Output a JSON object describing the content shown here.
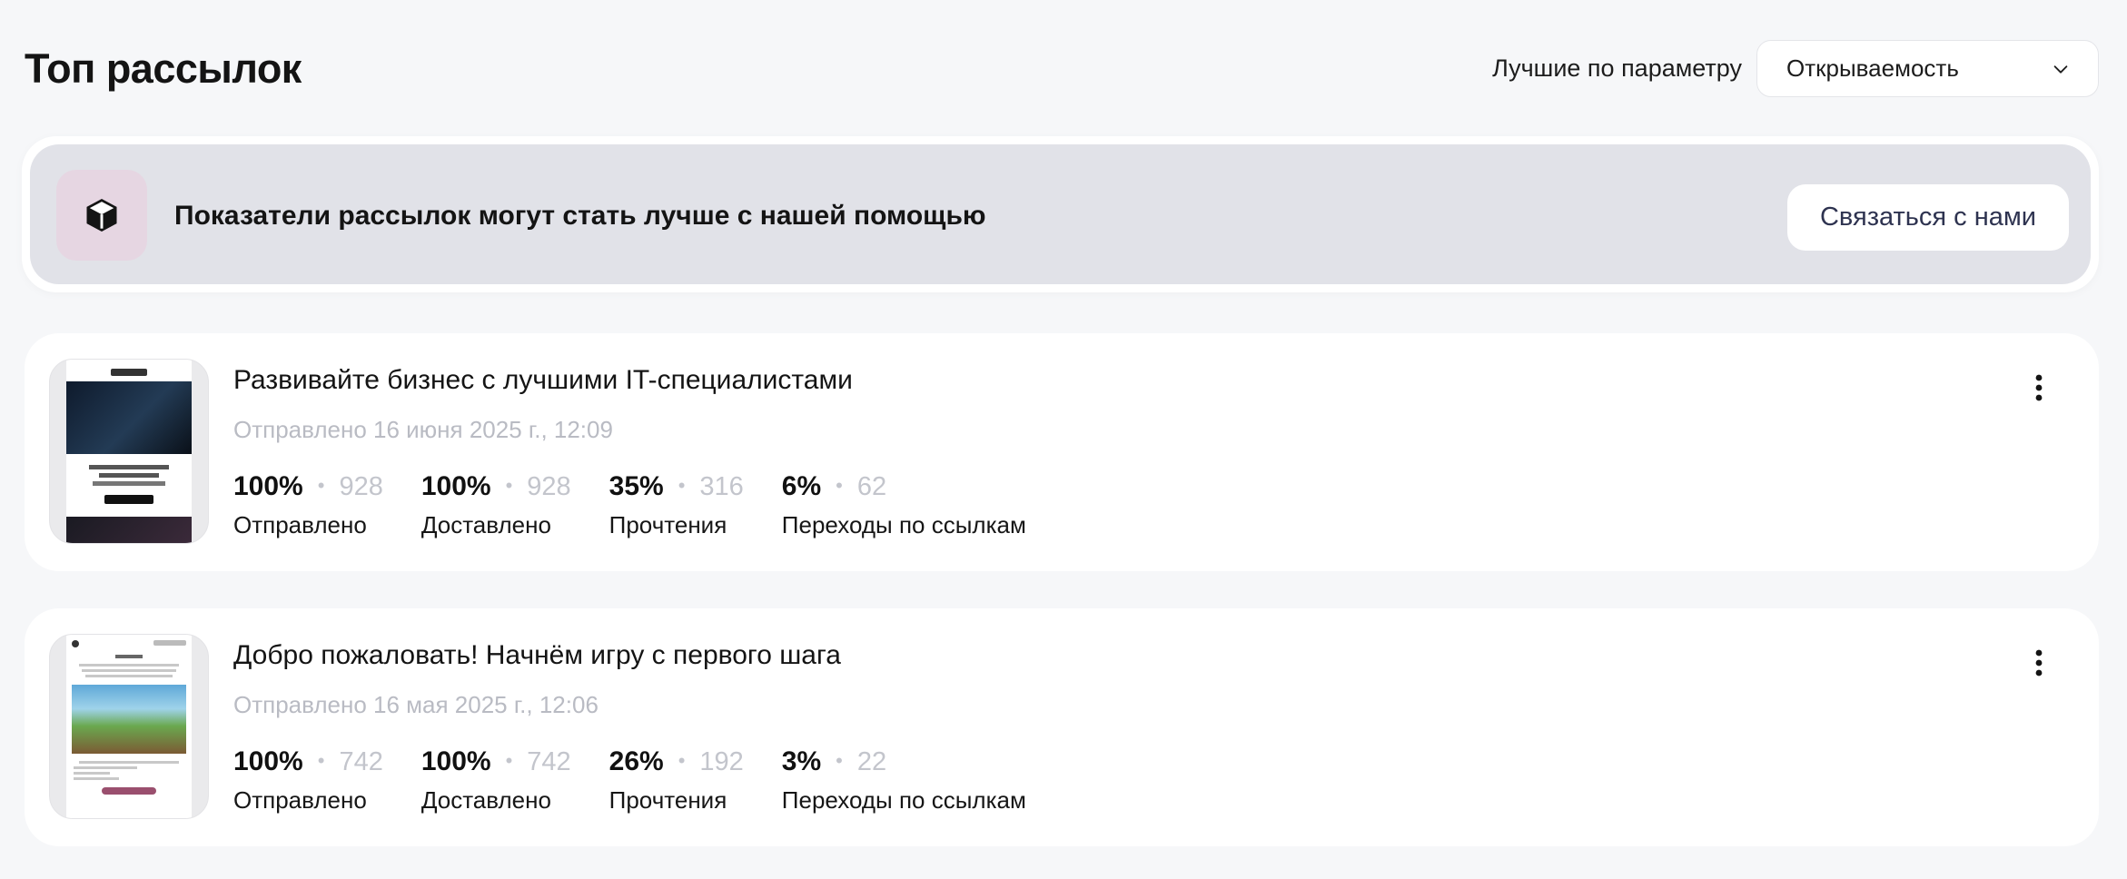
{
  "header": {
    "title": "Топ рассылок",
    "filter_label": "Лучшие по параметру",
    "filter_value": "Открываемость"
  },
  "banner": {
    "text": "Показатели рассылок могут стать лучше с нашей помощью",
    "button_label": "Связаться с нами",
    "icon": "cube-icon"
  },
  "campaigns": [
    {
      "title": "Развивайте бизнес с лучшими IT-специалистами",
      "date": "Отправлено 16 июня 2025 г., 12:09",
      "metrics": [
        {
          "pct": "100%",
          "count": "928",
          "label": "Отправлено"
        },
        {
          "pct": "100%",
          "count": "928",
          "label": "Доставлено"
        },
        {
          "pct": "35%",
          "count": "316",
          "label": "Прочтения"
        },
        {
          "pct": "6%",
          "count": "62",
          "label": "Переходы по ссылкам"
        }
      ]
    },
    {
      "title": "Добро пожаловать! Начнём игру с первого шага",
      "date": "Отправлено 16 мая 2025 г., 12:06",
      "metrics": [
        {
          "pct": "100%",
          "count": "742",
          "label": "Отправлено"
        },
        {
          "pct": "100%",
          "count": "742",
          "label": "Доставлено"
        },
        {
          "pct": "26%",
          "count": "192",
          "label": "Прочтения"
        },
        {
          "pct": "3%",
          "count": "22",
          "label": "Переходы по ссылкам"
        }
      ]
    }
  ],
  "colors": {
    "page_bg": "#f6f7f9",
    "banner_bg": "#e1e2e8",
    "icon_bg": "#e6d6e2",
    "muted_text": "#b9bbc3",
    "button_text": "#2e3350"
  }
}
